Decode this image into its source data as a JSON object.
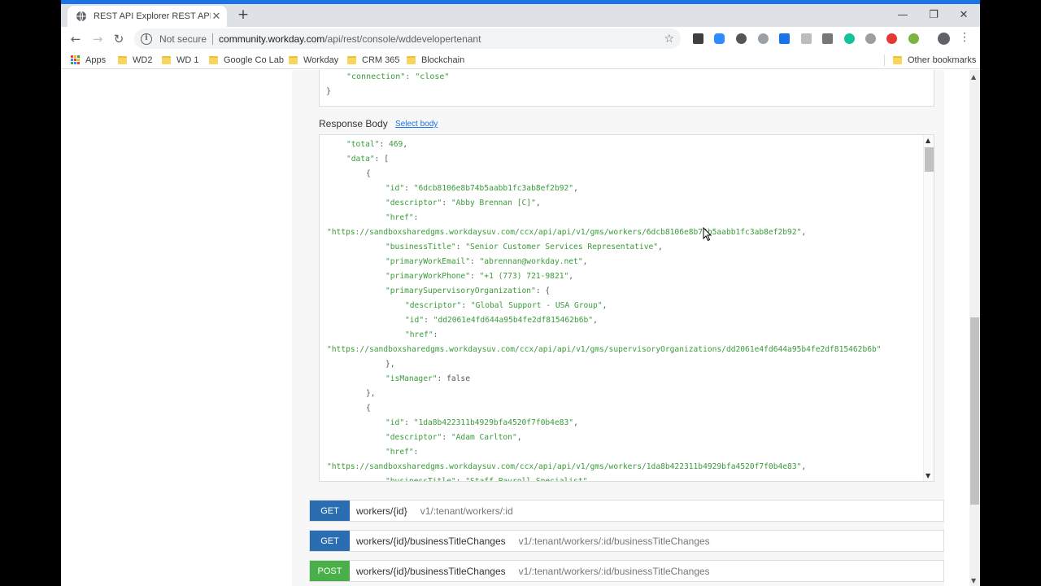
{
  "browser": {
    "tab_title": "REST API Explorer REST API Explo",
    "tab_close": "✕",
    "new_tab": "+",
    "omnibox": {
      "security_label": "Not secure",
      "url_host": "community.workday.com",
      "url_path": "/api/rest/console/wddevelopertenant"
    },
    "bookmarks": [
      "Apps",
      "WD2",
      "WD 1",
      "Google Co Lab",
      "Workday",
      "CRM 365",
      "Blockchain"
    ],
    "other_bookmarks": "Other bookmarks",
    "extension_icons": [
      "blue-square",
      "zoom-camera",
      "circle-dark",
      "grey-circle",
      "blue-check",
      "grey-square",
      "grey-grid",
      "grammarly-green",
      "grey-balloon",
      "red-spiral",
      "green-coin"
    ]
  },
  "headers_tail": {
    "line1": "\"connection\": \"close\"",
    "line2": "}"
  },
  "response": {
    "label": "Response Body",
    "select_link": "Select body",
    "lines": [
      {
        "i": 1,
        "parts": [
          [
            "k",
            "\"total\""
          ],
          [
            "p",
            ": "
          ],
          [
            "n",
            "469"
          ],
          [
            "p",
            ","
          ]
        ]
      },
      {
        "i": 1,
        "parts": [
          [
            "k",
            "\"data\""
          ],
          [
            "p",
            ": ["
          ]
        ]
      },
      {
        "i": 2,
        "parts": [
          [
            "p",
            "{"
          ]
        ]
      },
      {
        "i": 3,
        "parts": [
          [
            "k",
            "\"id\""
          ],
          [
            "p",
            ": "
          ],
          [
            "s",
            "\"6dcb8106e8b74b5aabb1fc3ab8ef2b92\""
          ],
          [
            "p",
            ","
          ]
        ]
      },
      {
        "i": 3,
        "parts": [
          [
            "k",
            "\"descriptor\""
          ],
          [
            "p",
            ": "
          ],
          [
            "s",
            "\"Abby Brennan [C]\""
          ],
          [
            "p",
            ","
          ]
        ]
      },
      {
        "i": 3,
        "parts": [
          [
            "k",
            "\"href\""
          ],
          [
            "p",
            ":"
          ]
        ]
      },
      {
        "i": 0,
        "parts": [
          [
            "s",
            "\"https://sandboxsharedgms.workdaysuv.com/ccx/api/api/v1/gms/workers/6dcb8106e8b74b5aabb1fc3ab8ef2b92\""
          ],
          [
            "p",
            ","
          ]
        ]
      },
      {
        "i": 3,
        "parts": [
          [
            "k",
            "\"businessTitle\""
          ],
          [
            "p",
            ": "
          ],
          [
            "s",
            "\"Senior Customer Services Representative\""
          ],
          [
            "p",
            ","
          ]
        ]
      },
      {
        "i": 3,
        "parts": [
          [
            "k",
            "\"primaryWorkEmail\""
          ],
          [
            "p",
            ": "
          ],
          [
            "s",
            "\"abrennan@workday.net\""
          ],
          [
            "p",
            ","
          ]
        ]
      },
      {
        "i": 3,
        "parts": [
          [
            "k",
            "\"primaryWorkPhone\""
          ],
          [
            "p",
            ": "
          ],
          [
            "s",
            "\"+1 (773) 721-9821\""
          ],
          [
            "p",
            ","
          ]
        ]
      },
      {
        "i": 3,
        "parts": [
          [
            "k",
            "\"primarySupervisoryOrganization\""
          ],
          [
            "p",
            ": {"
          ]
        ]
      },
      {
        "i": 4,
        "parts": [
          [
            "k",
            "\"descriptor\""
          ],
          [
            "p",
            ": "
          ],
          [
            "s",
            "\"Global Support - USA Group\""
          ],
          [
            "p",
            ","
          ]
        ]
      },
      {
        "i": 4,
        "parts": [
          [
            "k",
            "\"id\""
          ],
          [
            "p",
            ": "
          ],
          [
            "s",
            "\"dd2061e4fd644a95b4fe2df815462b6b\""
          ],
          [
            "p",
            ","
          ]
        ]
      },
      {
        "i": 4,
        "parts": [
          [
            "k",
            "\"href\""
          ],
          [
            "p",
            ":"
          ]
        ]
      },
      {
        "i": 0,
        "parts": [
          [
            "s",
            "\"https://sandboxsharedgms.workdaysuv.com/ccx/api/api/v1/gms/supervisoryOrganizations/dd2061e4fd644a95b4fe2df815462b6b\""
          ]
        ]
      },
      {
        "i": 3,
        "parts": [
          [
            "p",
            "},"
          ]
        ]
      },
      {
        "i": 3,
        "parts": [
          [
            "k",
            "\"isManager\""
          ],
          [
            "p",
            ": "
          ],
          [
            "kw",
            "false"
          ]
        ]
      },
      {
        "i": 2,
        "parts": [
          [
            "p",
            "},"
          ]
        ]
      },
      {
        "i": 2,
        "parts": [
          [
            "p",
            "{"
          ]
        ]
      },
      {
        "i": 3,
        "parts": [
          [
            "k",
            "\"id\""
          ],
          [
            "p",
            ": "
          ],
          [
            "s",
            "\"1da8b422311b4929bfa4520f7f0b4e83\""
          ],
          [
            "p",
            ","
          ]
        ]
      },
      {
        "i": 3,
        "parts": [
          [
            "k",
            "\"descriptor\""
          ],
          [
            "p",
            ": "
          ],
          [
            "s",
            "\"Adam Carlton\""
          ],
          [
            "p",
            ","
          ]
        ]
      },
      {
        "i": 3,
        "parts": [
          [
            "k",
            "\"href\""
          ],
          [
            "p",
            ":"
          ]
        ]
      },
      {
        "i": 0,
        "parts": [
          [
            "s",
            "\"https://sandboxsharedgms.workdaysuv.com/ccx/api/api/v1/gms/workers/1da8b422311b4929bfa4520f7f0b4e83\""
          ],
          [
            "p",
            ","
          ]
        ]
      },
      {
        "i": 3,
        "parts": [
          [
            "k",
            "\"businessTitle\""
          ],
          [
            "p",
            ": "
          ],
          [
            "s",
            "\"Staff Payroll Specialist\""
          ],
          [
            "p",
            ","
          ]
        ]
      }
    ]
  },
  "endpoints": [
    {
      "method": "GET",
      "name": "workers/{id}",
      "path": "v1/:tenant/workers/:id"
    },
    {
      "method": "GET",
      "name": "workers/{id}/businessTitleChanges",
      "path": "v1/:tenant/workers/:id/businessTitleChanges"
    },
    {
      "method": "POST",
      "name": "workers/{id}/businessTitleChanges",
      "path": "v1/:tenant/workers/:id/businessTitleChanges"
    }
  ],
  "colors": {
    "get": "#2a6db0",
    "post": "#49b049",
    "json": "#3a9a3a",
    "link": "#1a73e8"
  }
}
